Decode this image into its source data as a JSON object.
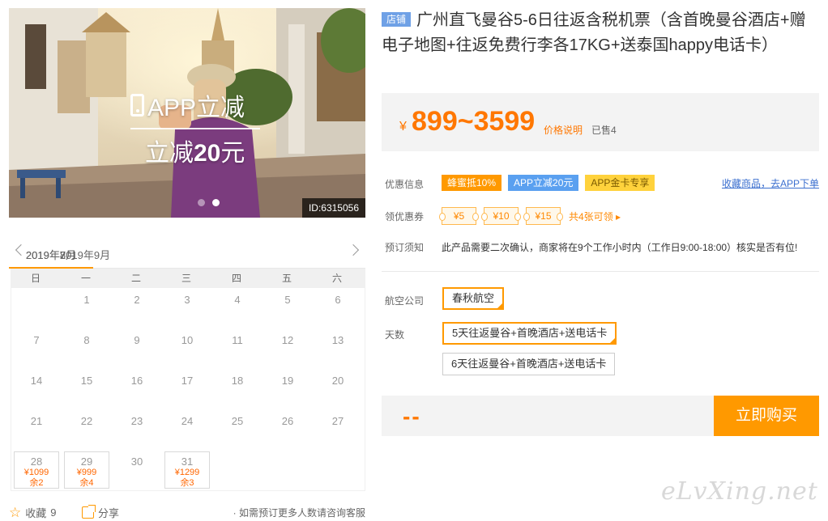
{
  "hero": {
    "promo_line1": "APP立减",
    "promo_line2_prefix": "立减",
    "promo_line2_amount": "20",
    "promo_line2_suffix": "元",
    "id_label": "ID:6315056",
    "slides": 2,
    "active_slide": 2
  },
  "calendar": {
    "months": [
      "2019年7月",
      "2019年8月",
      "2019年9月"
    ],
    "active_month": 0,
    "weekdays": [
      "日",
      "一",
      "二",
      "三",
      "四",
      "五",
      "六"
    ],
    "leading_blanks": 1,
    "days": [
      {
        "d": "1"
      },
      {
        "d": "2"
      },
      {
        "d": "3"
      },
      {
        "d": "4"
      },
      {
        "d": "5"
      },
      {
        "d": "6"
      },
      {
        "d": "7"
      },
      {
        "d": "8"
      },
      {
        "d": "9"
      },
      {
        "d": "10"
      },
      {
        "d": "11"
      },
      {
        "d": "12"
      },
      {
        "d": "13"
      },
      {
        "d": "14"
      },
      {
        "d": "15"
      },
      {
        "d": "16"
      },
      {
        "d": "17"
      },
      {
        "d": "18"
      },
      {
        "d": "19"
      },
      {
        "d": "20"
      },
      {
        "d": "21"
      },
      {
        "d": "22"
      },
      {
        "d": "23"
      },
      {
        "d": "24"
      },
      {
        "d": "25"
      },
      {
        "d": "26"
      },
      {
        "d": "27"
      },
      {
        "d": "28",
        "price": "¥1099",
        "remain": "余2"
      },
      {
        "d": "29",
        "price": "¥999",
        "remain": "余4"
      },
      {
        "d": "30"
      },
      {
        "d": "31",
        "price": "¥1299",
        "remain": "余3"
      }
    ]
  },
  "bottom": {
    "favorite_label": "收藏",
    "favorite_count": "9",
    "share_label": "分享",
    "consult_text": "如需预订更多人数请咨询客服"
  },
  "product": {
    "tag": "店铺",
    "title": "广州直飞曼谷5-6日往返含税机票（含首晚曼谷酒店+赠电子地图+往返免费行李各17KG+送泰国happy电话卡）",
    "currency": "¥",
    "price": "899~3599",
    "price_note": "价格说明",
    "sold": "已售4"
  },
  "promo": {
    "label": "优惠信息",
    "badges": [
      "蜂蜜抵10%",
      "APP立减20元",
      "APP金卡专享"
    ],
    "fav_link": "收藏商品，去APP下单"
  },
  "coupons": {
    "label": "领优惠券",
    "items": [
      "¥5",
      "¥10",
      "¥15"
    ],
    "more": "共4张可领 ▸"
  },
  "notice": {
    "label": "预订须知",
    "text": "此产品需要二次确认，商家将在9个工作小时内（工作日9:00-18:00）核实是否有位!"
  },
  "airline": {
    "label": "航空公司",
    "options": [
      "春秋航空"
    ]
  },
  "duration": {
    "label": "天数",
    "options": [
      "5天往返曼谷+首晚酒店+送电话卡",
      "6天往返曼谷+首晚酒店+送电话卡"
    ]
  },
  "buy": {
    "total": "--",
    "button": "立即购买"
  },
  "watermark": "eLvXing.net",
  "colors": {
    "accent": "#ff9900",
    "price": "#ff7700",
    "link": "#3b6fcf"
  }
}
